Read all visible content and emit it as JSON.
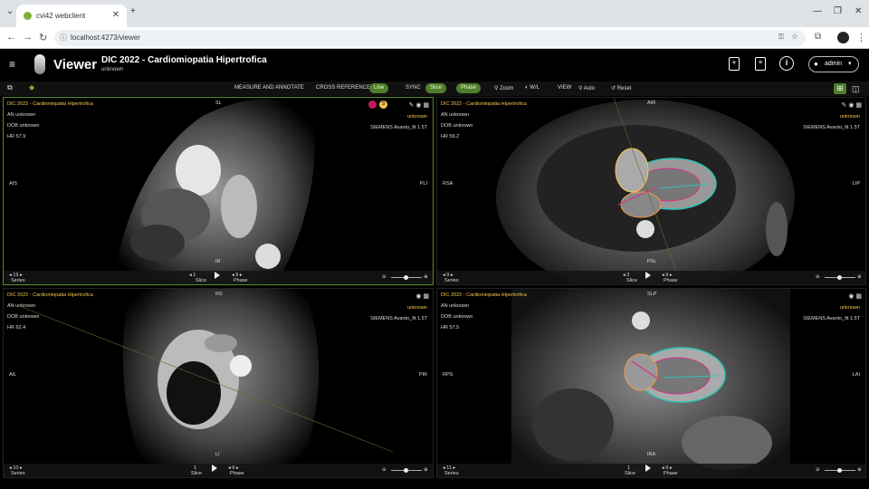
{
  "browser": {
    "tab_title": "cvi42 webclient",
    "url": "localhost:4273/viewer",
    "new_tab": "+",
    "tab_close": "✕"
  },
  "app": {
    "name": "Viewer",
    "study_title": "DIC 2022 - Cardiomiopatia Hipertrofica",
    "study_subtitle": "unknown",
    "user": "admin"
  },
  "toolbar": {
    "measure": "MEASURE AND ANNOTATE",
    "cross_ref": "CROSS REFERENCE",
    "line": "Line",
    "sync": "SYNC",
    "slice": "Slice",
    "phase": "Phase",
    "zoom": "Zoom",
    "wl": "W/L",
    "view": "VIEW",
    "auto": "Auto",
    "reset": "Reset"
  },
  "viewports": [
    {
      "title": "DIC 2022 - Cardiomiopatia Hipertrofica",
      "an": "AN unknown",
      "dob": "DOB unknown",
      "hr": "HR 57.9",
      "right1": "unknown",
      "right2": "SIEMENS Avanto_fit 1.5T",
      "top": "SL",
      "bottom": "IR",
      "left": "AIS",
      "right": "PLI",
      "series": "19",
      "series_label": "Series",
      "slice": "1",
      "slice_label": "Slice",
      "phase": "9",
      "phase_label": "Phase"
    },
    {
      "title": "DIC 2022 - Cardiomiopatia Hipertrofica",
      "an": "AN unknown",
      "dob": "DOB unknown",
      "hr": "HR 59.2",
      "right1": "unknown",
      "right2": "SIEMENS Avanto_fit 1.5T",
      "top": "AIR",
      "bottom": "PSL",
      "left": "RSA",
      "right": "LIP",
      "series": "9",
      "series_label": "Series",
      "slice": "3",
      "slice_label": "Slice",
      "phase": "9",
      "phase_label": "Phase"
    },
    {
      "title": "DIC 2022 - Cardiomiopatia Hipertrofica",
      "an": "AN unknown",
      "dob": "DOB unknown",
      "hr": "HR 62.4",
      "right1": "unknown",
      "right2": "SIEMENS Avanto_fit 1.5T",
      "top": "RS",
      "bottom": "LI",
      "left": "AIL",
      "right": "PIR",
      "series": "10",
      "series_label": "Series",
      "slice": "1",
      "slice_label": "Slice",
      "phase": "9",
      "phase_label": "Phase"
    },
    {
      "title": "DIC 2022 - Cardiomiopatia Hipertrofica",
      "an": "AN unknown",
      "dob": "DOB unknown",
      "hr": "HR 57.5",
      "right1": "unknown",
      "right2": "SIEMENS Avanto_fit 1.5T",
      "top": "SLP",
      "bottom": "IRA",
      "left": "RPS",
      "right": "LAI",
      "series": "11",
      "series_label": "Series",
      "slice": "1",
      "slice_label": "Slice",
      "phase": "9",
      "phase_label": "Phase"
    }
  ],
  "colors": {
    "accent": "#5a8a2a",
    "overlay_text": "#f2c94c"
  }
}
